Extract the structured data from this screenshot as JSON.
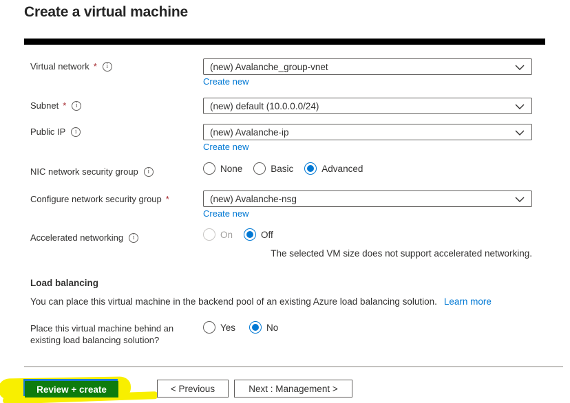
{
  "page": {
    "title": "Create a virtual machine"
  },
  "colors": {
    "accent_blue": "#0078d4",
    "link_blue": "#0078d4",
    "required_red": "#a4262c",
    "text": "#323130",
    "input_border": "#605e5c",
    "disabled_gray": "#a19f9d",
    "divider_gray": "#c4c2c0",
    "redaction_black": "#000000",
    "highlight_yellow": "#f8ef00",
    "highlighted_button_green": "#0e7c0e"
  },
  "form": {
    "virtual_network": {
      "label": "Virtual network",
      "required": "*",
      "value": "(new) Avalanche_group-vnet",
      "create_new": "Create new"
    },
    "subnet": {
      "label": "Subnet",
      "required": "*",
      "value": "(new) default (10.0.0.0/24)"
    },
    "public_ip": {
      "label": "Public IP",
      "value": "(new) Avalanche-ip",
      "create_new": "Create new"
    },
    "nic_nsg": {
      "label": "NIC network security group",
      "options": {
        "none": "None",
        "basic": "Basic",
        "advanced": "Advanced"
      },
      "selected": "Advanced"
    },
    "configure_nsg": {
      "label": "Configure network security group",
      "required": "*",
      "value": "(new) Avalanche-nsg",
      "create_new": "Create new"
    },
    "accelerated_networking": {
      "label": "Accelerated networking",
      "options": {
        "on": "On",
        "off": "Off"
      },
      "selected": "Off",
      "note": "The selected VM size does not support accelerated networking."
    }
  },
  "load_balancing": {
    "heading": "Load balancing",
    "description": "You can place this virtual machine in the backend pool of an existing Azure load balancing solution.",
    "learn_more": "Learn more",
    "question": {
      "label_line1": "Place this virtual machine behind an",
      "label_line2": "existing load balancing solution?",
      "options": {
        "yes": "Yes",
        "no": "No"
      },
      "selected": "No"
    }
  },
  "footer": {
    "review_create_label": "Review + create",
    "previous_label": "< Previous",
    "next_label": "Next : Management >"
  }
}
